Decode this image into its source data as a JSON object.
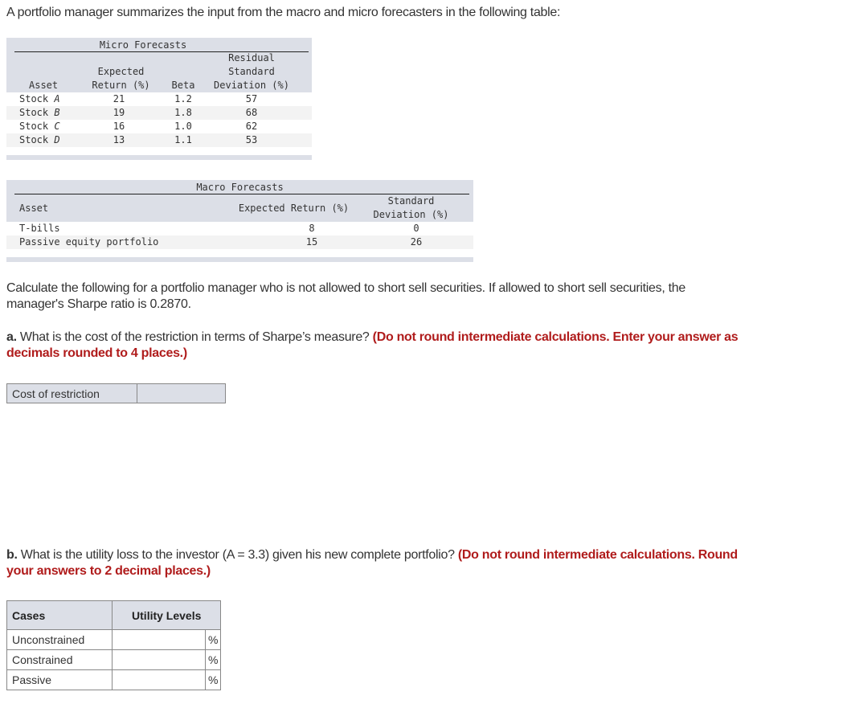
{
  "intro": "A portfolio manager summarizes the input from the macro and micro forecasters in the following table:",
  "micro": {
    "title": "Micro Forecasts",
    "headers": {
      "asset": "Asset",
      "ret_1": "Expected",
      "ret_2": "Return (%)",
      "beta": "Beta",
      "resid_1": "Residual",
      "resid_2": "Standard",
      "resid_3": "Deviation (%)"
    },
    "rows": [
      {
        "prefix": "Stock ",
        "letter": "A",
        "ret": "21",
        "beta": "1.2",
        "resid": "57"
      },
      {
        "prefix": "Stock ",
        "letter": "B",
        "ret": "19",
        "beta": "1.8",
        "resid": "68"
      },
      {
        "prefix": "Stock ",
        "letter": "C",
        "ret": "16",
        "beta": "1.0",
        "resid": "62"
      },
      {
        "prefix": "Stock ",
        "letter": "D",
        "ret": "13",
        "beta": "1.1",
        "resid": "53"
      }
    ]
  },
  "macro": {
    "title": "Macro Forecasts",
    "headers": {
      "asset": "Asset",
      "ret": "Expected Return (%)",
      "sd_1": "Standard",
      "sd_2": "Deviation (%)"
    },
    "rows": [
      {
        "asset": "T-bills",
        "ret": "8",
        "sd": "0"
      },
      {
        "asset": "Passive equity portfolio",
        "ret": "15",
        "sd": "26"
      }
    ]
  },
  "calc_text_1": "Calculate the following for a portfolio manager who is not allowed to short sell securities. If allowed to short sell securities, the",
  "calc_text_2": "manager's Sharpe ratio is 0.2870.",
  "question_a": {
    "label": "a.",
    "text": " What is the cost of the restriction in terms of Sharpe’s measure? ",
    "note_1": "(Do not round intermediate calculations. Enter your answer as",
    "note_2": "decimals rounded to 4 places.)"
  },
  "cost_table": {
    "label": "Cost of restriction",
    "value": ""
  },
  "question_b": {
    "label": "b.",
    "text": " What is the utility loss to the investor (A = 3.3) given his new complete portfolio? ",
    "note_1": "(Do not round intermediate calculations. Round",
    "note_2": "your answers to 2 decimal places.)"
  },
  "util_table": {
    "headers": {
      "cases": "Cases",
      "levels": "Utility Levels"
    },
    "rows": [
      {
        "case": "Unconstrained",
        "value": "",
        "unit": "%"
      },
      {
        "case": "Constrained",
        "value": "",
        "unit": "%"
      },
      {
        "case": "Passive",
        "value": "",
        "unit": "%"
      }
    ]
  }
}
